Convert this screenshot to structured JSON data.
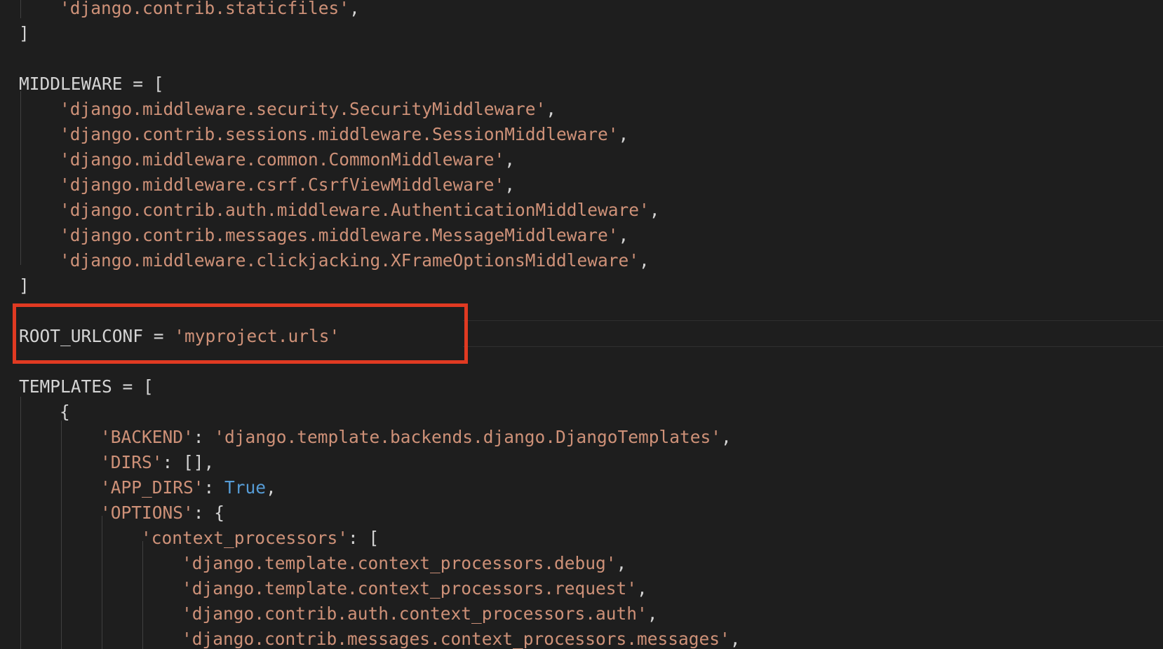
{
  "editor": {
    "accent_color": "#e03a22",
    "colors": {
      "string": "#ce9178",
      "keyword": "#569cd6",
      "text": "#d4d4d4",
      "background": "#1e1e1e"
    },
    "lines": [
      {
        "segments": [
          {
            "t": "'django.contrib.staticfiles'",
            "c": "str"
          },
          {
            "t": ",",
            "c": "pn"
          }
        ]
      },
      {
        "segments": [
          {
            "t": "]",
            "c": "pn"
          }
        ]
      },
      {
        "segments": [
          {
            "t": "",
            "c": "pn"
          }
        ]
      },
      {
        "segments": [
          {
            "t": "MIDDLEWARE = [",
            "c": "pn"
          }
        ]
      },
      {
        "segments": [
          {
            "t": "'django.middleware.security.SecurityMiddleware'",
            "c": "str"
          },
          {
            "t": ",",
            "c": "pn"
          }
        ]
      },
      {
        "segments": [
          {
            "t": "'django.contrib.sessions.middleware.SessionMiddleware'",
            "c": "str"
          },
          {
            "t": ",",
            "c": "pn"
          }
        ]
      },
      {
        "segments": [
          {
            "t": "'django.middleware.common.CommonMiddleware'",
            "c": "str"
          },
          {
            "t": ",",
            "c": "pn"
          }
        ]
      },
      {
        "segments": [
          {
            "t": "'django.middleware.csrf.CsrfViewMiddleware'",
            "c": "str"
          },
          {
            "t": ",",
            "c": "pn"
          }
        ]
      },
      {
        "segments": [
          {
            "t": "'django.contrib.auth.middleware.AuthenticationMiddleware'",
            "c": "str"
          },
          {
            "t": ",",
            "c": "pn"
          }
        ]
      },
      {
        "segments": [
          {
            "t": "'django.contrib.messages.middleware.MessageMiddleware'",
            "c": "str"
          },
          {
            "t": ",",
            "c": "pn"
          }
        ]
      },
      {
        "segments": [
          {
            "t": "'django.middleware.clickjacking.XFrameOptionsMiddleware'",
            "c": "str"
          },
          {
            "t": ",",
            "c": "pn"
          }
        ]
      },
      {
        "segments": [
          {
            "t": "]",
            "c": "pn"
          }
        ]
      },
      {
        "segments": [
          {
            "t": "",
            "c": "pn"
          }
        ]
      },
      {
        "segments": [
          {
            "t": "ROOT_URLCONF = ",
            "c": "pn"
          },
          {
            "t": "'myproject.urls'",
            "c": "str"
          }
        ]
      },
      {
        "segments": [
          {
            "t": "",
            "c": "pn"
          }
        ]
      },
      {
        "segments": [
          {
            "t": "TEMPLATES = [",
            "c": "pn"
          }
        ]
      },
      {
        "segments": [
          {
            "t": "{",
            "c": "pn"
          }
        ]
      },
      {
        "segments": [
          {
            "t": "'BACKEND'",
            "c": "str"
          },
          {
            "t": ": ",
            "c": "pn"
          },
          {
            "t": "'django.template.backends.django.DjangoTemplates'",
            "c": "str"
          },
          {
            "t": ",",
            "c": "pn"
          }
        ]
      },
      {
        "segments": [
          {
            "t": "'DIRS'",
            "c": "str"
          },
          {
            "t": ": [],",
            "c": "pn"
          }
        ]
      },
      {
        "segments": [
          {
            "t": "'APP_DIRS'",
            "c": "str"
          },
          {
            "t": ": ",
            "c": "pn"
          },
          {
            "t": "True",
            "c": "kw"
          },
          {
            "t": ",",
            "c": "pn"
          }
        ]
      },
      {
        "segments": [
          {
            "t": "'OPTIONS'",
            "c": "str"
          },
          {
            "t": ": {",
            "c": "pn"
          }
        ]
      },
      {
        "segments": [
          {
            "t": "'context_processors'",
            "c": "str"
          },
          {
            "t": ": [",
            "c": "pn"
          }
        ]
      },
      {
        "segments": [
          {
            "t": "'django.template.context_processors.debug'",
            "c": "str"
          },
          {
            "t": ",",
            "c": "pn"
          }
        ]
      },
      {
        "segments": [
          {
            "t": "'django.template.context_processors.request'",
            "c": "str"
          },
          {
            "t": ",",
            "c": "pn"
          }
        ]
      },
      {
        "segments": [
          {
            "t": "'django.contrib.auth.context_processors.auth'",
            "c": "str"
          },
          {
            "t": ",",
            "c": "pn"
          }
        ]
      },
      {
        "segments": [
          {
            "t": "'django.contrib.messages.context_processors.messages'",
            "c": "str"
          },
          {
            "t": ",",
            "c": "pn"
          }
        ]
      }
    ]
  }
}
